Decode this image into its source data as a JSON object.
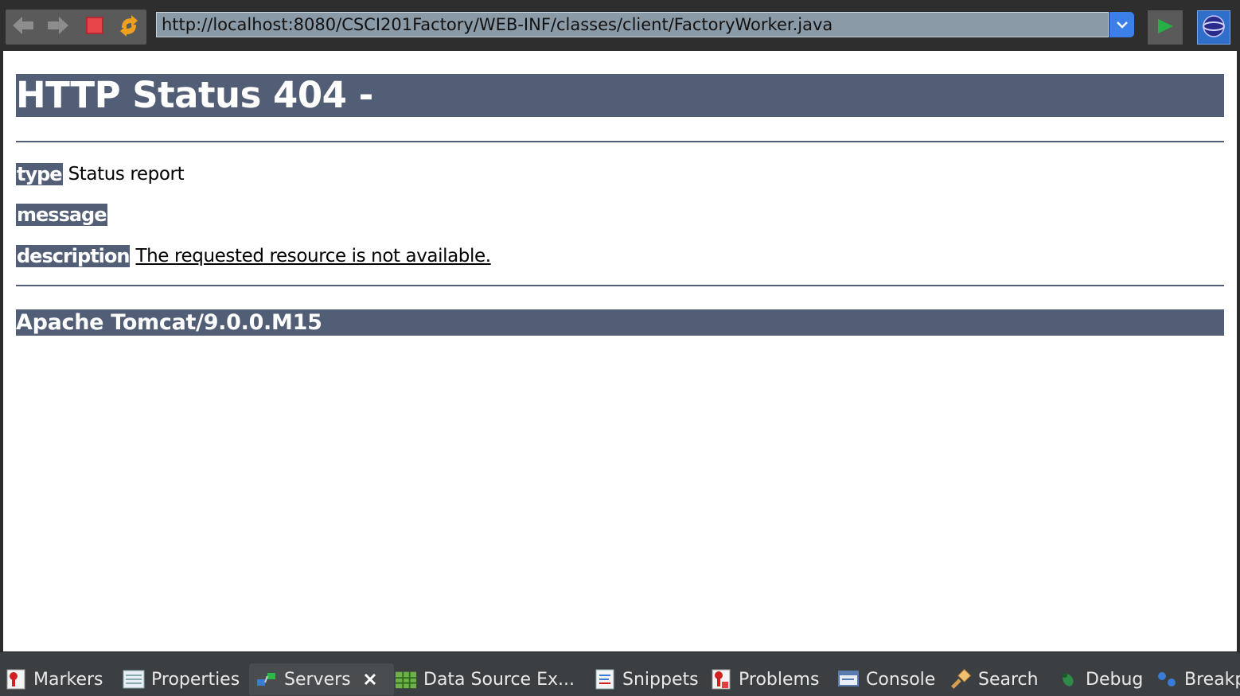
{
  "toolbar": {
    "back_icon": "back-arrow-icon",
    "forward_icon": "forward-arrow-icon",
    "stop_icon": "stop-icon",
    "refresh_icon": "refresh-icon",
    "url": "http://localhost:8080/CSCI201Factory/WEB-INF/classes/client/FactoryWorker.java",
    "go_icon": "go-icon",
    "globe_icon": "browser-globe-icon"
  },
  "page": {
    "title": "HTTP Status 404 -",
    "type_label": "type",
    "type_value": "Status report",
    "message_label": "message",
    "message_value": "",
    "description_label": "description",
    "description_value": "The requested resource is not available.",
    "footer": "Apache Tomcat/9.0.0.M15"
  },
  "tabs": [
    {
      "label": "Markers",
      "icon": "markers-icon"
    },
    {
      "label": "Properties",
      "icon": "properties-icon"
    },
    {
      "label": "Servers",
      "icon": "servers-icon",
      "active": true
    },
    {
      "label": "Data Source Ex...",
      "icon": "data-source-icon"
    },
    {
      "label": "Snippets",
      "icon": "snippets-icon"
    },
    {
      "label": "Problems",
      "icon": "problems-icon"
    },
    {
      "label": "Console",
      "icon": "console-icon"
    },
    {
      "label": "Search",
      "icon": "search-icon"
    },
    {
      "label": "Debug",
      "icon": "debug-icon"
    },
    {
      "label": "Breakp",
      "icon": "breakpoints-icon"
    }
  ],
  "colors": {
    "heading_bg": "#525d76",
    "toolbar_bg": "#2e2e2e",
    "tabbar_bg": "#3c3f41"
  }
}
